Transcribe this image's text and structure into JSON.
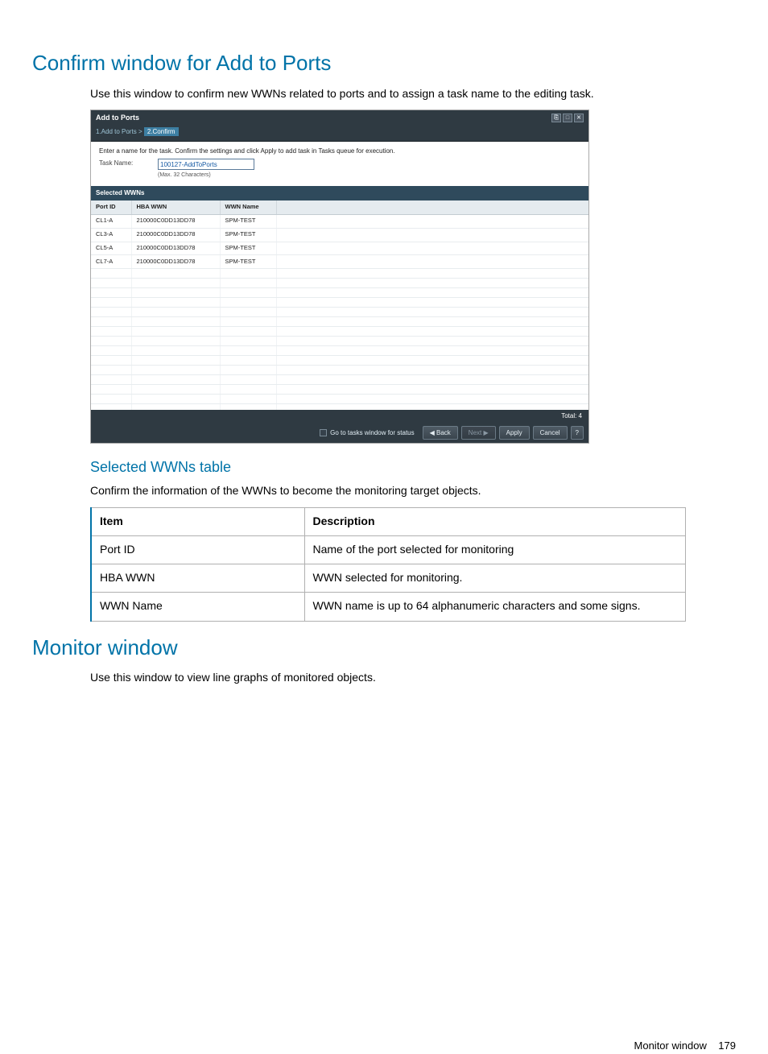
{
  "heading1": "Confirm window for Add to Ports",
  "para1": "Use this window to confirm new WWNs related to ports and to assign a task name to the editing task.",
  "mock": {
    "title": "Add to Ports",
    "win": {
      "pin": "⎘",
      "max": "□",
      "close": "✕"
    },
    "crumb_prev": "1.Add to Ports",
    "crumb_sep": ">",
    "crumb_active": "2.Confirm",
    "instruction": "Enter a name for the task. Confirm the settings and click Apply to add task in Tasks queue for execution.",
    "task_label": "Task Name:",
    "task_value": "100127-AddToPorts",
    "task_hint": "(Max. 32 Characters)",
    "subheader": "Selected WWNs",
    "cols": [
      "Port ID",
      "HBA WWN",
      "WWN Name"
    ],
    "rows": [
      {
        "port": "CL1-A",
        "wwn": "210000C0DD13DD78",
        "name": "SPM-TEST"
      },
      {
        "port": "CL3-A",
        "wwn": "210000C0DD13DD78",
        "name": "SPM-TEST"
      },
      {
        "port": "CL5-A",
        "wwn": "210000C0DD13DD78",
        "name": "SPM-TEST"
      },
      {
        "port": "CL7-A",
        "wwn": "210000C0DD13DD78",
        "name": "SPM-TEST"
      }
    ],
    "total_label": "Total: 4",
    "go_tasks": "Go to tasks window for status",
    "btn_back": "◀ Back",
    "btn_next": "Next ▶",
    "btn_apply": "Apply",
    "btn_cancel": "Cancel",
    "btn_help": "?"
  },
  "subheading": "Selected WWNs table",
  "para2": "Confirm the information of the WWNs to become the monitoring target objects.",
  "def_table": {
    "head": [
      "Item",
      "Description"
    ],
    "rows": [
      [
        "Port ID",
        "Name of the port selected for monitoring"
      ],
      [
        "HBA WWN",
        "WWN selected for monitoring."
      ],
      [
        "WWN Name",
        "WWN name is up to 64 alphanumeric characters and some signs."
      ]
    ]
  },
  "heading2": "Monitor window",
  "para3": "Use this window to view line graphs of monitored objects.",
  "footer_label": "Monitor window",
  "footer_page": "179"
}
